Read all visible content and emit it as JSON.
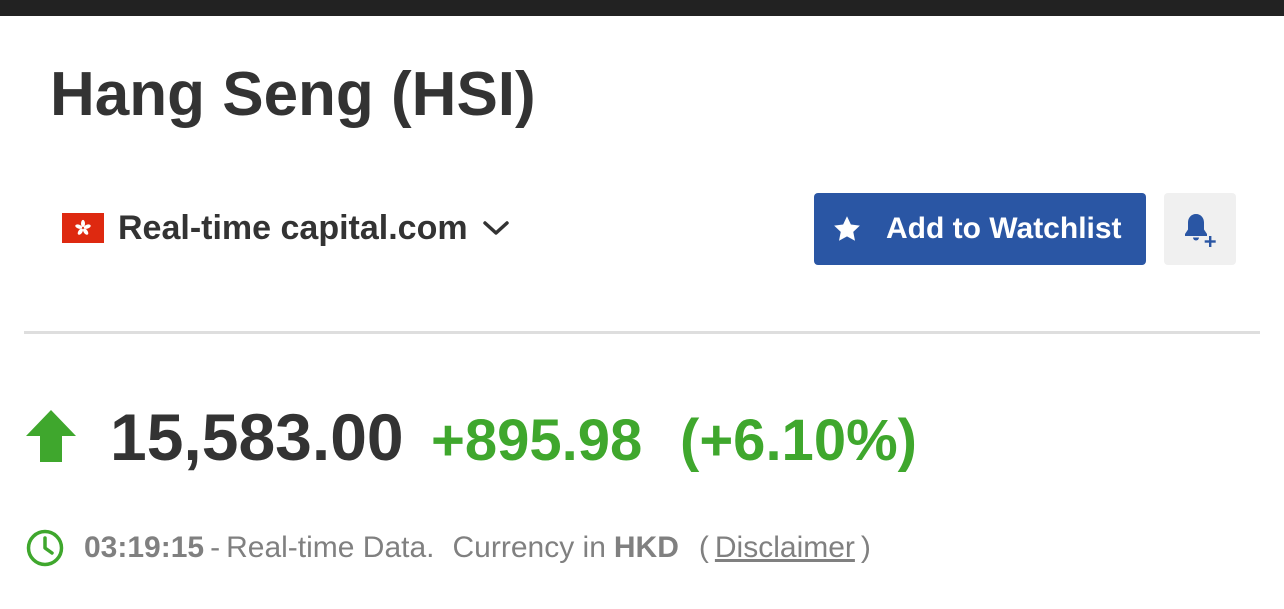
{
  "header": {
    "title": "Hang Seng (HSI)"
  },
  "source": {
    "flag_icon": "hong-kong-flag-icon",
    "label": "Real-time capital.com",
    "dropdown_icon": "chevron-down-icon"
  },
  "actions": {
    "watchlist_label": "Add to Watchlist",
    "watchlist_icon": "star-icon",
    "alert_icon": "bell-plus-icon"
  },
  "quote": {
    "direction_icon": "arrow-up-icon",
    "price": "15,583.00",
    "change": "+895.98",
    "change_percent": "(+6.10%)"
  },
  "info": {
    "clock_icon": "clock-icon",
    "time": "03:19:15",
    "separator": "-",
    "data_type": "Real-time Data.",
    "currency_prefix": "Currency in",
    "currency": "HKD",
    "paren_open": "(",
    "disclaimer_label": "Disclaimer",
    "paren_close": ")"
  },
  "colors": {
    "top_bar": "#222222",
    "primary_button": "#2a56a4",
    "positive": "#3fa72d",
    "flag_red": "#de2910",
    "text_dark": "#333333",
    "text_muted": "#808080"
  }
}
